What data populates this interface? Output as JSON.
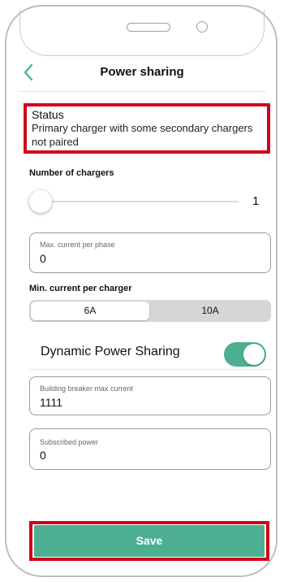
{
  "header": {
    "title": "Power sharing",
    "back_icon": "chevron-left-icon"
  },
  "status": {
    "title": "Status",
    "text": "Primary charger with some secondary chargers not paired"
  },
  "chargers": {
    "label": "Number of chargers",
    "value": "1",
    "slider_fraction": 0
  },
  "max_current": {
    "label": "Max. current per phase",
    "value": "0"
  },
  "min_current": {
    "label": "Min. current per charger",
    "options": [
      "6A",
      "10A"
    ],
    "selected": "6A"
  },
  "dynamic_power_sharing": {
    "label": "Dynamic Power Sharing",
    "enabled": true
  },
  "building_breaker": {
    "label": "Building breaker max current",
    "value": "1111"
  },
  "subscribed_power": {
    "label": "Subscribed power",
    "value": "0"
  },
  "save_label": "Save",
  "colors": {
    "accent": "#4caf92",
    "highlight": "#d0021b"
  }
}
